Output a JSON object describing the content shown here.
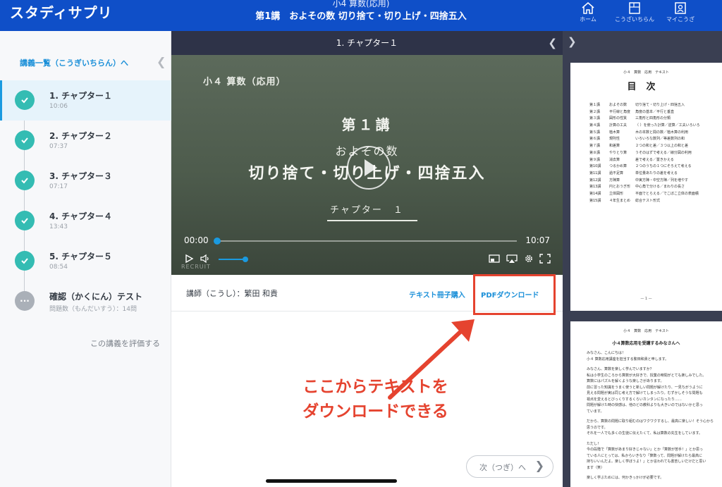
{
  "header": {
    "logo": "スタディサプリ",
    "course_sub": "小4 算数(応用)",
    "course_title": "第1講　およその数 切り捨て・切り上げ・四捨五入",
    "nav": [
      {
        "icon": "home-icon",
        "label": "ホーム"
      },
      {
        "icon": "book-icon",
        "label": "こうざいちらん"
      },
      {
        "icon": "profile-icon",
        "label": "マイこうざ"
      }
    ]
  },
  "sidebar": {
    "back_link": "講義一覧（こうぎいちらん）へ",
    "chapters": [
      {
        "label": "1. チャプター１",
        "sub": "10:06",
        "done": true
      },
      {
        "label": "2. チャプター２",
        "sub": "07:37",
        "done": true
      },
      {
        "label": "3. チャプター３",
        "sub": "07:17",
        "done": true
      },
      {
        "label": "4. チャプター４",
        "sub": "13:43",
        "done": true
      },
      {
        "label": "5. チャプター５",
        "sub": "08:54",
        "done": true
      },
      {
        "label": "確認（かくにん）テスト",
        "sub": "問題数（もんだいすう）：14問",
        "done": false
      }
    ],
    "rate_link": "この講義を評価する"
  },
  "player": {
    "chapter_bar": "1. チャプター１",
    "board": {
      "subject": "小４ 算数（応用）",
      "lecture": "第１講",
      "topic": "およその数",
      "main": "切り捨て・切り上げ・四捨五入",
      "chapter": "チャプター　１"
    },
    "time_current": "00:00",
    "time_total": "10:07",
    "progress": 0,
    "volume": 0.85,
    "watermark": "RECRUIT"
  },
  "info": {
    "instructor": "講師（こうし）：繁田 和貴",
    "buy_link": "テキスト冊子購入",
    "pdf_link": "PDFダウンロード"
  },
  "annotation": {
    "line1": "ここからテキストを",
    "line2": "ダウンロードできる",
    "color": "#e5432f"
  },
  "next_button": "次（つぎ）へ",
  "pdf": {
    "page1": {
      "header": "小４　算数　応用　テキスト",
      "title": "目次",
      "toc": [
        {
          "n": "第１講",
          "t": "およその数",
          "d": "切り捨て・切り上げ・四捨五入"
        },
        {
          "n": "第２講",
          "t": "平行線と角度",
          "d": "角度の基本／平行と垂直"
        },
        {
          "n": "第３講",
          "t": "図形の性質",
          "d": "三角形と四角形の分類"
        },
        {
          "n": "第４講",
          "t": "計算の工夫",
          "d": "（ ）を使った計算／逆算／工夫いろいろ"
        },
        {
          "n": "第５講",
          "t": "植木算",
          "d": "木の本数と間の数／植木算の利用"
        },
        {
          "n": "第６講",
          "t": "規則性",
          "d": "いろいろな数列／等差数列の和"
        },
        {
          "n": "第７講",
          "t": "和差算",
          "d": "２つの和と差／３つ以上の和と差"
        },
        {
          "n": "第８講",
          "t": "やりとり算",
          "d": "うそのはずで考える／線分図の利用"
        },
        {
          "n": "第９講",
          "t": "消去算",
          "d": "差で考える／置きかえる"
        },
        {
          "n": "第10講",
          "t": "つるかめ算",
          "d": "２つのうちの１つにそろえて考える"
        },
        {
          "n": "第11講",
          "t": "過不足算",
          "d": "単位量あたりの差を考える"
        },
        {
          "n": "第12講",
          "t": "方陣算",
          "d": "中実方陣・中空方陣／列を増やす"
        },
        {
          "n": "第13講",
          "t": "円とおうぎ形",
          "d": "中心角で分ける／まわりの長さ"
        },
        {
          "n": "第14講",
          "t": "立体図形",
          "d": "平面でとらえる／でこぼこ立体の表面積"
        },
        {
          "n": "第15講",
          "t": "４年生まとめ",
          "d": "総合テスト形式"
        }
      ],
      "page_number": "— 1 —"
    },
    "page2": {
      "header": "小４　算数　応用　テキスト",
      "title": "小４算数応用を受講するみなさんへ",
      "lines": [
        "みなさん、こんにちは！",
        "小４ 算数応用講座を担当する繁田和貴と申します。",
        "",
        "みなさん、算数を楽しく学んでいますか？",
        "私は小学生のころから算数が大好きで、授業の時間がとても楽しみでした。",
        "算数にはパズルを解くような楽しさがあります。",
        "前に習った知識をうまく使うと新しい問題が解けたり、一見ちがうように",
        "見える問題が実は同じ考え方で解けてしまったり。むずかしそうな問題も",
        "視点を変えるとびっくりするくらいカンタンになったり……",
        "問題が解けた時の快感は、他のどの教科よりも大きいのではないかと思っ",
        "ています。",
        "",
        "だから、算数の問題に取り組むのはワクワクするし、最高に楽しい！そう心から",
        "思うのです。",
        "それを一人でも多くの生徒に伝えたくて、私は算数の先生をしています。",
        "",
        "ただし！",
        "今の段階で「算数があまり好きじゃない」とか「算数が苦手！」とか思っ",
        "ている人にとっては、私からいきなり「算数って、問題が解けたら最高に",
        "持ちいいんだよ。楽しく学ぼうよ！」とか言われても書苦しいだけだと思い",
        "ます（笑）",
        "",
        "楽しく学ぶためには、何かきっかけが必要です。"
      ]
    }
  }
}
